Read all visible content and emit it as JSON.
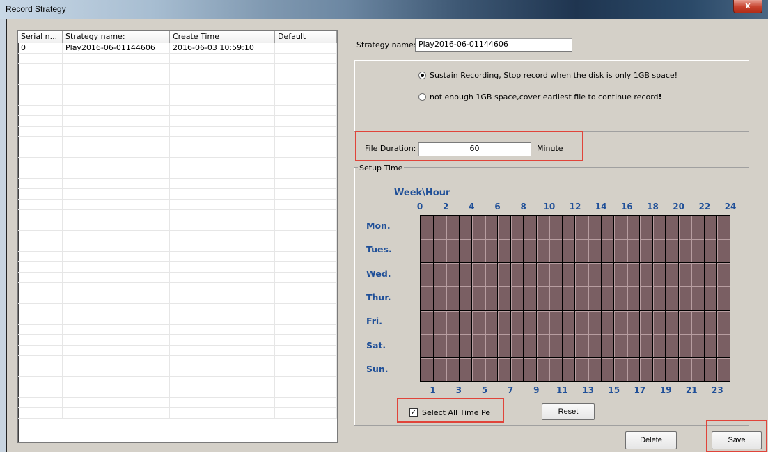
{
  "window": {
    "title": "Record Strategy",
    "close_glyph": "x"
  },
  "list": {
    "columns": [
      "Serial n...",
      "Strategy name:",
      "Create Time",
      "Default"
    ],
    "rows": [
      {
        "serial": "0",
        "name": "Play2016-06-01144606",
        "time": "2016-06-03 10:59:10",
        "default": ""
      }
    ]
  },
  "form": {
    "strategy_name_label": "Strategy name:",
    "strategy_name_value": "Play2016-06-01144606",
    "radio_sustain_label": "Sustain Recording, Stop record when the disk is only 1GB space!",
    "radio_cover_label": "not enough 1GB space,cover earliest file to continue record",
    "radio_cover_mark": "!",
    "selected_radio": "sustain",
    "file_duration_label": "File Duration:",
    "file_duration_value": "60",
    "file_duration_unit": "Minute",
    "setup_time_label": "Setup Time"
  },
  "schedule": {
    "header": "Week\\Hour",
    "top_hours": [
      "0",
      "2",
      "4",
      "6",
      "8",
      "10",
      "12",
      "14",
      "16",
      "18",
      "20",
      "22",
      "24"
    ],
    "bottom_hours": [
      "1",
      "3",
      "5",
      "7",
      "9",
      "11",
      "13",
      "15",
      "17",
      "19",
      "21",
      "23"
    ],
    "days": [
      "Mon.",
      "Tues.",
      "Wed.",
      "Thur.",
      "Fri.",
      "Sat.",
      "Sun."
    ],
    "cell_color": "#7a5f63",
    "all_selected": true
  },
  "controls": {
    "select_all_label": "Select All Time Pe",
    "select_all_checked": true,
    "check_glyph": "✓",
    "reset_label": "Reset",
    "delete_label": "Delete",
    "save_label": "Save"
  },
  "colors": {
    "highlight": "#e0443a",
    "accent_text": "#1f4f98"
  }
}
